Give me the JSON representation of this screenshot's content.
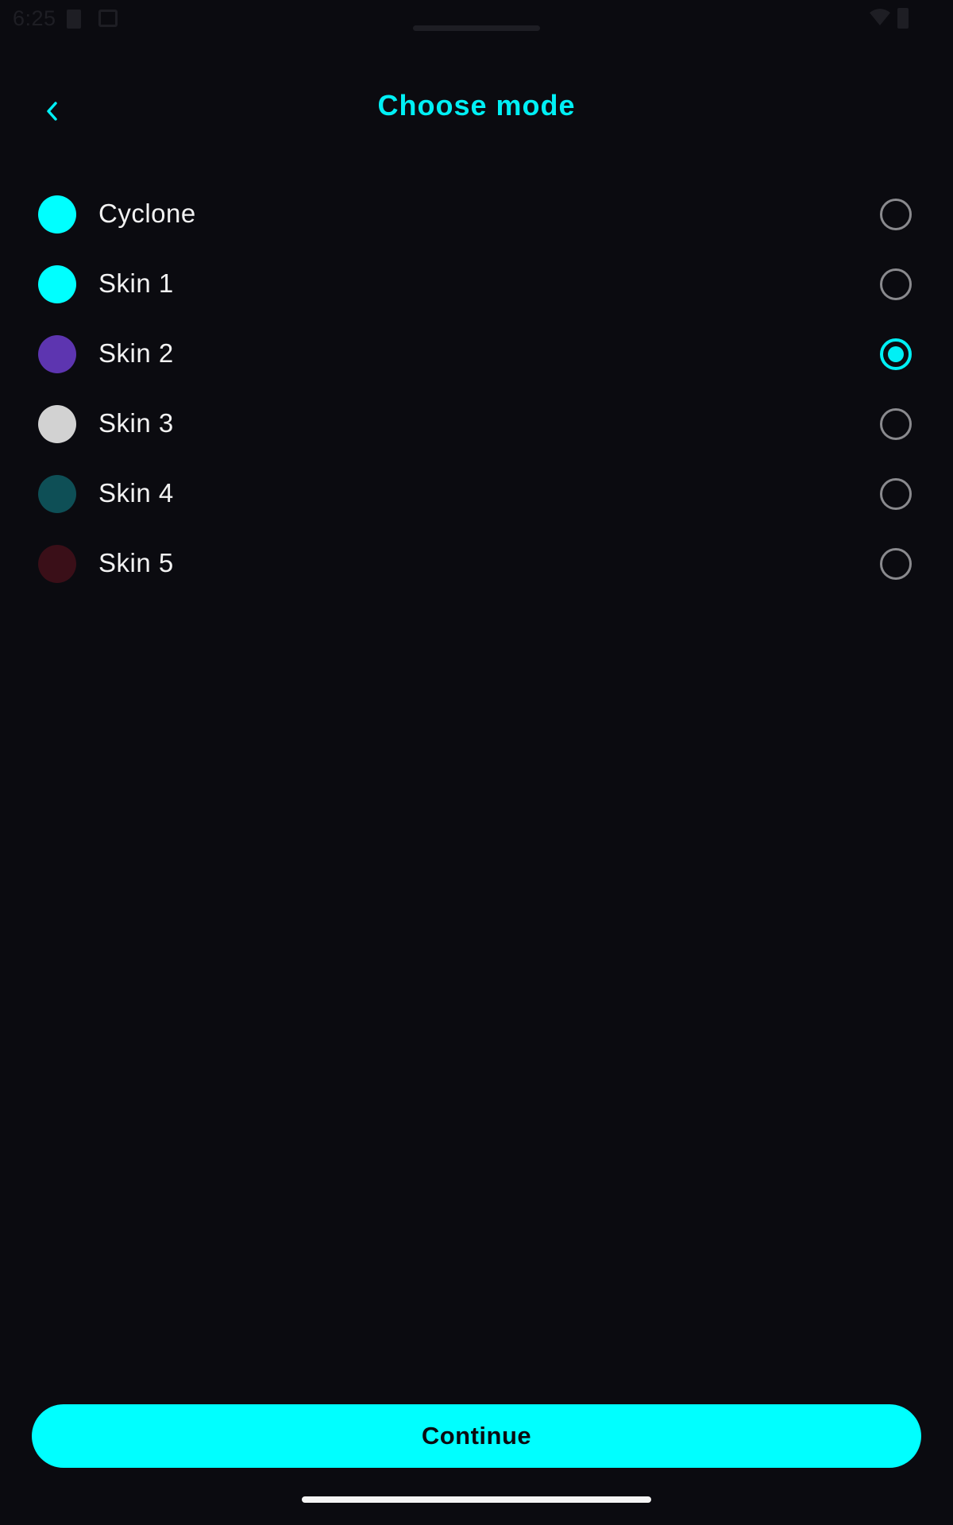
{
  "status_bar": {
    "time": "6:25"
  },
  "header": {
    "title": "Choose mode",
    "back_icon": "chevron-left-icon"
  },
  "modes": [
    {
      "label": "Cyclone",
      "color": "#00ffff",
      "selected": false
    },
    {
      "label": "Skin 1",
      "color": "#00ffff",
      "selected": false
    },
    {
      "label": "Skin 2",
      "color": "#5d35b0",
      "selected": true
    },
    {
      "label": "Skin 3",
      "color": "#d2d2d2",
      "selected": false
    },
    {
      "label": "Skin 4",
      "color": "#0e4f56",
      "selected": false
    },
    {
      "label": "Skin 5",
      "color": "#3a0f18",
      "selected": false
    }
  ],
  "footer": {
    "continue_label": "Continue"
  },
  "colors": {
    "accent": "#00f0f5",
    "background": "#0b0b10",
    "radio_unselected": "#8a8a8e"
  }
}
